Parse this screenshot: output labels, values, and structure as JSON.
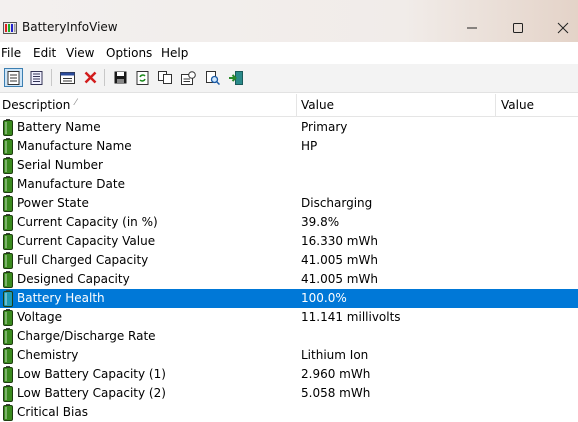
{
  "window": {
    "title": "BatteryInfoView"
  },
  "menu": [
    "File",
    "Edit",
    "View",
    "Options",
    "Help"
  ],
  "columns": {
    "description": "Description",
    "value": "Value",
    "value2": "Value"
  },
  "rows": [
    {
      "description": "Battery Name",
      "value": "Primary"
    },
    {
      "description": "Manufacture Name",
      "value": "HP"
    },
    {
      "description": "Serial Number",
      "value": ""
    },
    {
      "description": "Manufacture Date",
      "value": ""
    },
    {
      "description": "Power State",
      "value": "Discharging"
    },
    {
      "description": "Current Capacity (in %)",
      "value": "39.8%"
    },
    {
      "description": "Current Capacity Value",
      "value": "16.330 mWh"
    },
    {
      "description": "Full Charged Capacity",
      "value": "41.005 mWh"
    },
    {
      "description": "Designed Capacity",
      "value": "41.005 mWh"
    },
    {
      "description": "Battery Health",
      "value": "100.0%",
      "selected": true
    },
    {
      "description": "Voltage",
      "value": "11.141 millivolts"
    },
    {
      "description": "Charge/Discharge Rate",
      "value": ""
    },
    {
      "description": "Chemistry",
      "value": "Lithium Ion"
    },
    {
      "description": "Low Battery Capacity (1)",
      "value": "2.960 mWh"
    },
    {
      "description": "Low Battery Capacity (2)",
      "value": "5.058 mWh"
    },
    {
      "description": "Critical Bias",
      "value": ""
    }
  ],
  "colors": {
    "selection": "#0078d7",
    "battery_green": "#3a8a1e",
    "battery_selected": "#1f9ab3"
  },
  "icons": {
    "toolbar": [
      "battery-info-view-icon",
      "battery-log-view-icon",
      "properties-icon",
      "delete-icon",
      "save-icon",
      "refresh-icon",
      "copy-icon",
      "html-report-icon",
      "find-icon",
      "exit-icon"
    ],
    "row": "battery-icon"
  }
}
